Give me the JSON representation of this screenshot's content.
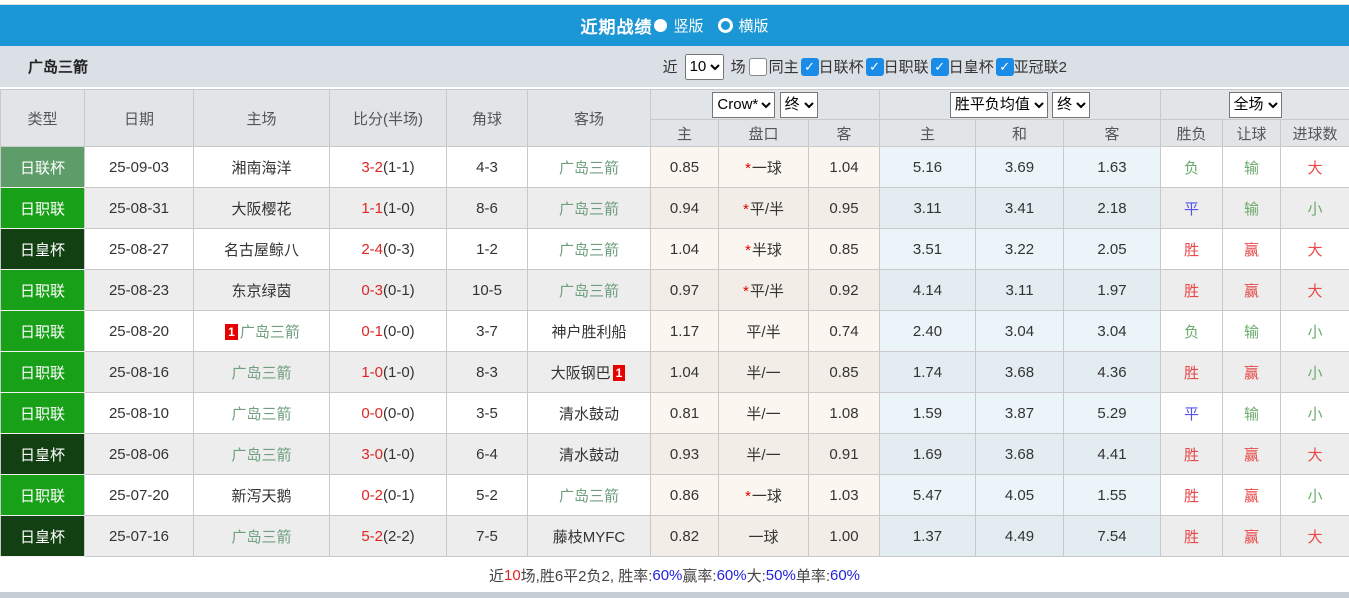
{
  "title_bar": {
    "title": "近期战绩",
    "radios": [
      {
        "label": "竖版",
        "selected": true
      },
      {
        "label": "横版",
        "selected": false
      }
    ]
  },
  "filter_bar": {
    "team": "广岛三箭",
    "near_label": "近",
    "games_value": "10",
    "games_label": "场",
    "checkboxes": [
      {
        "label": "同主",
        "checked": false
      },
      {
        "label": "日联杯",
        "checked": true
      },
      {
        "label": "日职联",
        "checked": true
      },
      {
        "label": "日皇杯",
        "checked": true
      },
      {
        "label": "亚冠联2",
        "checked": true
      }
    ]
  },
  "table": {
    "headers": [
      "类型",
      "日期",
      "主场",
      "比分(半场)",
      "角球",
      "客场"
    ],
    "selects": {
      "company": "Crow*",
      "company_time": "终",
      "average": "胜平负均值",
      "average_time": "终",
      "scope": "全场"
    },
    "sub_headers": [
      "主",
      "盘口",
      "客",
      "主",
      "和",
      "客",
      "胜负",
      "让球",
      "进球数"
    ],
    "rows": [
      {
        "type": "日联杯",
        "date": "25-09-03",
        "home": {
          "name": "湘南海洋",
          "green": false
        },
        "score": "3-2",
        "half": "(1-1)",
        "corners": "4-3",
        "away": {
          "name": "广岛三箭",
          "green": true
        },
        "odds": {
          "home": "0.85",
          "star": true,
          "line": "一球",
          "away": "1.04"
        },
        "avg": [
          "5.16",
          "3.69",
          "1.63"
        ],
        "outcome": {
          "text": "负",
          "color": "green"
        },
        "handicap": {
          "text": "输",
          "color": "green"
        },
        "goals": {
          "text": "大",
          "color": "red"
        }
      },
      {
        "type": "日职联",
        "date": "25-08-31",
        "home": {
          "name": "大阪樱花",
          "green": false
        },
        "score": "1-1",
        "half": "(1-0)",
        "corners": "8-6",
        "away": {
          "name": "广岛三箭",
          "green": true
        },
        "odds": {
          "home": "0.94",
          "star": true,
          "line": "平/半",
          "away": "0.95"
        },
        "avg": [
          "3.11",
          "3.41",
          "2.18"
        ],
        "outcome": {
          "text": "平",
          "color": "blue"
        },
        "handicap": {
          "text": "输",
          "color": "green"
        },
        "goals": {
          "text": "小",
          "color": "green"
        }
      },
      {
        "type": "日皇杯",
        "date": "25-08-27",
        "home": {
          "name": "名古屋鲸八",
          "green": false
        },
        "score": "2-4",
        "half": "(0-3)",
        "corners": "1-2",
        "away": {
          "name": "广岛三箭",
          "green": true
        },
        "odds": {
          "home": "1.04",
          "star": true,
          "line": "半球",
          "away": "0.85"
        },
        "avg": [
          "3.51",
          "3.22",
          "2.05"
        ],
        "outcome": {
          "text": "胜",
          "color": "red"
        },
        "handicap": {
          "text": "赢",
          "color": "red"
        },
        "goals": {
          "text": "大",
          "color": "red"
        }
      },
      {
        "type": "日职联",
        "date": "25-08-23",
        "home": {
          "name": "东京绿茵",
          "green": false
        },
        "score": "0-3",
        "half": "(0-1)",
        "corners": "10-5",
        "away": {
          "name": "广岛三箭",
          "green": true
        },
        "odds": {
          "home": "0.97",
          "star": true,
          "line": "平/半",
          "away": "0.92"
        },
        "avg": [
          "4.14",
          "3.11",
          "1.97"
        ],
        "outcome": {
          "text": "胜",
          "color": "red"
        },
        "handicap": {
          "text": "赢",
          "color": "red"
        },
        "goals": {
          "text": "大",
          "color": "red"
        }
      },
      {
        "type": "日职联",
        "date": "25-08-20",
        "home": {
          "name": "广岛三箭",
          "green": true,
          "badge_before": "1"
        },
        "score": "0-1",
        "half": "(0-0)",
        "corners": "3-7",
        "away": {
          "name": "神户胜利船",
          "green": false
        },
        "odds": {
          "home": "1.17",
          "star": false,
          "line": "平/半",
          "away": "0.74"
        },
        "avg": [
          "2.40",
          "3.04",
          "3.04"
        ],
        "outcome": {
          "text": "负",
          "color": "green"
        },
        "handicap": {
          "text": "输",
          "color": "green"
        },
        "goals": {
          "text": "小",
          "color": "green"
        }
      },
      {
        "type": "日职联",
        "date": "25-08-16",
        "home": {
          "name": "广岛三箭",
          "green": true
        },
        "score": "1-0",
        "half": "(1-0)",
        "corners": "8-3",
        "away": {
          "name": "大阪钢巴",
          "green": false,
          "badge_after": "1"
        },
        "odds": {
          "home": "1.04",
          "star": false,
          "line": "半/一",
          "away": "0.85"
        },
        "avg": [
          "1.74",
          "3.68",
          "4.36"
        ],
        "outcome": {
          "text": "胜",
          "color": "red"
        },
        "handicap": {
          "text": "赢",
          "color": "red"
        },
        "goals": {
          "text": "小",
          "color": "green"
        }
      },
      {
        "type": "日职联",
        "date": "25-08-10",
        "home": {
          "name": "广岛三箭",
          "green": true
        },
        "score": "0-0",
        "half": "(0-0)",
        "corners": "3-5",
        "away": {
          "name": "清水鼓动",
          "green": false
        },
        "odds": {
          "home": "0.81",
          "star": false,
          "line": "半/一",
          "away": "1.08"
        },
        "avg": [
          "1.59",
          "3.87",
          "5.29"
        ],
        "outcome": {
          "text": "平",
          "color": "blue"
        },
        "handicap": {
          "text": "输",
          "color": "green"
        },
        "goals": {
          "text": "小",
          "color": "green"
        }
      },
      {
        "type": "日皇杯",
        "date": "25-08-06",
        "home": {
          "name": "广岛三箭",
          "green": true
        },
        "score": "3-0",
        "half": "(1-0)",
        "corners": "6-4",
        "away": {
          "name": "清水鼓动",
          "green": false
        },
        "odds": {
          "home": "0.93",
          "star": false,
          "line": "半/一",
          "away": "0.91"
        },
        "avg": [
          "1.69",
          "3.68",
          "4.41"
        ],
        "outcome": {
          "text": "胜",
          "color": "red"
        },
        "handicap": {
          "text": "赢",
          "color": "red"
        },
        "goals": {
          "text": "大",
          "color": "red"
        }
      },
      {
        "type": "日职联",
        "date": "25-07-20",
        "home": {
          "name": "新泻天鹅",
          "green": false
        },
        "score": "0-2",
        "half": "(0-1)",
        "corners": "5-2",
        "away": {
          "name": "广岛三箭",
          "green": true
        },
        "odds": {
          "home": "0.86",
          "star": true,
          "line": "一球",
          "away": "1.03"
        },
        "avg": [
          "5.47",
          "4.05",
          "1.55"
        ],
        "outcome": {
          "text": "胜",
          "color": "red"
        },
        "handicap": {
          "text": "赢",
          "color": "red"
        },
        "goals": {
          "text": "小",
          "color": "green"
        }
      },
      {
        "type": "日皇杯",
        "date": "25-07-16",
        "home": {
          "name": "广岛三箭",
          "green": true
        },
        "score": "5-2",
        "half": "(2-2)",
        "corners": "7-5",
        "away": {
          "name": "藤枝MYFC",
          "green": false
        },
        "odds": {
          "home": "0.82",
          "star": false,
          "line": "一球",
          "away": "1.00"
        },
        "avg": [
          "1.37",
          "4.49",
          "7.54"
        ],
        "outcome": {
          "text": "胜",
          "color": "red"
        },
        "handicap": {
          "text": "赢",
          "color": "red"
        },
        "goals": {
          "text": "大",
          "color": "red"
        }
      }
    ]
  },
  "footer": {
    "parts": [
      {
        "text": "近",
        "color": "base"
      },
      {
        "text": "10",
        "color": "red"
      },
      {
        "text": "场,胜6平2负2, 胜率:",
        "color": "base"
      },
      {
        "text": "60%",
        "color": "blue"
      },
      {
        "text": " 赢率:",
        "color": "base"
      },
      {
        "text": "60%",
        "color": "blue"
      },
      {
        "text": " 大:",
        "color": "base"
      },
      {
        "text": "50%",
        "color": "blue"
      },
      {
        "text": " 单率:",
        "color": "base"
      },
      {
        "text": "60%",
        "color": "blue"
      }
    ]
  },
  "colors": {
    "accent_blue": "#1c97d6",
    "checkbox_blue": "#1a8ce8",
    "leagues": {
      "日联杯": "#5e9d6a",
      "日职联": "#18a018",
      "日皇杯": "#134013"
    },
    "team_green": "#6f9f7f",
    "score_red": "#e02525",
    "badge_red": "#e60000",
    "result": {
      "red": "#e84848",
      "blue": "#5353ea",
      "green": "#6cab6c"
    },
    "footer": {
      "base": "#444444",
      "red": "#e02525",
      "blue": "#2222dd"
    }
  }
}
